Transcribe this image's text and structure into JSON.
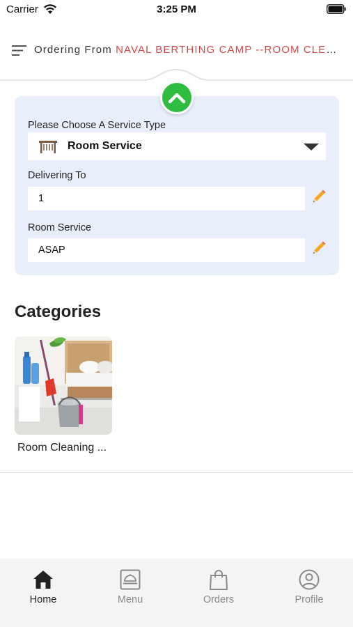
{
  "status_bar": {
    "carrier": "Carrier",
    "time": "3:25 PM"
  },
  "header": {
    "prefix": "Ordering From",
    "location": "NAVAL BERTHING CAMP --ROOM CLEAN..."
  },
  "service_card": {
    "service_type_label": "Please Choose A Service Type",
    "service_type_value": "Room Service",
    "delivering_label": "Delivering To",
    "delivering_value": "1",
    "timing_label": "Room Service",
    "timing_value": "ASAP"
  },
  "categories": {
    "title": "Categories",
    "items": [
      {
        "label": "Room Cleaning ..."
      }
    ]
  },
  "tab_bar": {
    "tabs": [
      {
        "label": "Home",
        "icon": "home-icon",
        "active": true
      },
      {
        "label": "Menu",
        "icon": "menu-tray-icon",
        "active": false
      },
      {
        "label": "Orders",
        "icon": "shopping-bag-icon",
        "active": false
      },
      {
        "label": "Profile",
        "icon": "profile-icon",
        "active": false
      }
    ]
  },
  "colors": {
    "accent_green": "#2ebd3e",
    "location_red": "#d64545",
    "card_background": "#e8eefa",
    "edit_pencil": "#f5a623"
  }
}
